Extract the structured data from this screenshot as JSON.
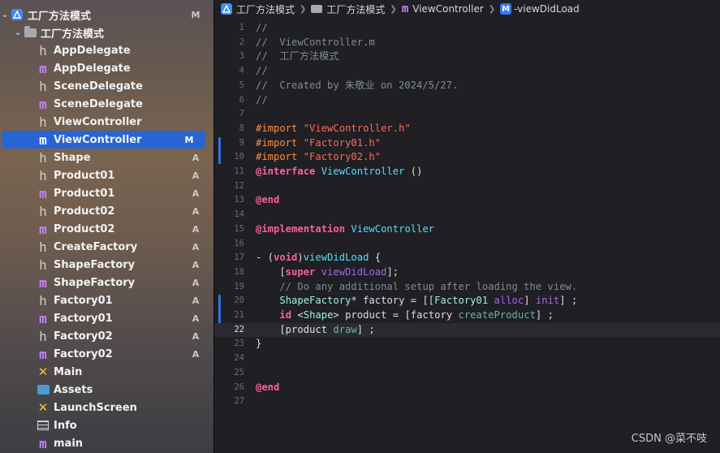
{
  "navigator": {
    "project": {
      "label": "工厂方法模式",
      "status": "M"
    },
    "group": {
      "label": "工厂方法模式"
    },
    "files": [
      {
        "label": "AppDelegate",
        "kind": "h",
        "status": ""
      },
      {
        "label": "AppDelegate",
        "kind": "m",
        "status": ""
      },
      {
        "label": "SceneDelegate",
        "kind": "h",
        "status": ""
      },
      {
        "label": "SceneDelegate",
        "kind": "m",
        "status": ""
      },
      {
        "label": "ViewController",
        "kind": "h",
        "status": ""
      },
      {
        "label": "ViewController",
        "kind": "m",
        "status": "M",
        "selected": true
      },
      {
        "label": "Shape",
        "kind": "h",
        "status": "A"
      },
      {
        "label": "Product01",
        "kind": "h",
        "status": "A"
      },
      {
        "label": "Product01",
        "kind": "m",
        "status": "A"
      },
      {
        "label": "Product02",
        "kind": "h",
        "status": "A"
      },
      {
        "label": "Product02",
        "kind": "m",
        "status": "A"
      },
      {
        "label": "CreateFactory",
        "kind": "h",
        "status": "A"
      },
      {
        "label": "ShapeFactory",
        "kind": "h",
        "status": "A"
      },
      {
        "label": "ShapeFactory",
        "kind": "m",
        "status": "A"
      },
      {
        "label": "Factory01",
        "kind": "h",
        "status": "A"
      },
      {
        "label": "Factory01",
        "kind": "m",
        "status": "A"
      },
      {
        "label": "Factory02",
        "kind": "h",
        "status": "A"
      },
      {
        "label": "Factory02",
        "kind": "m",
        "status": "A"
      },
      {
        "label": "Main",
        "kind": "storyboard",
        "status": ""
      },
      {
        "label": "Assets",
        "kind": "assets",
        "status": ""
      },
      {
        "label": "LaunchScreen",
        "kind": "storyboard",
        "status": ""
      },
      {
        "label": "Info",
        "kind": "plist",
        "status": ""
      },
      {
        "label": "main",
        "kind": "m",
        "status": ""
      }
    ]
  },
  "jumpbar": {
    "project": "工厂方法模式",
    "group": "工厂方法模式",
    "file": "ViewController",
    "method_badge": "M",
    "method": "-viewDidLoad"
  },
  "editor": {
    "current_line": 22,
    "changed_lines": [
      9,
      10,
      20,
      21,
      22
    ],
    "lines": [
      {
        "n": "1",
        "tokens": [
          [
            "c",
            "//"
          ]
        ]
      },
      {
        "n": "2",
        "tokens": [
          [
            "c",
            "//  ViewController.m"
          ]
        ]
      },
      {
        "n": "3",
        "tokens": [
          [
            "c",
            "//  工厂方法模式"
          ]
        ]
      },
      {
        "n": "4",
        "tokens": [
          [
            "c",
            "//"
          ]
        ]
      },
      {
        "n": "5",
        "tokens": [
          [
            "c",
            "//  Created by 朱敬业 on 2024/5/27."
          ]
        ]
      },
      {
        "n": "6",
        "tokens": [
          [
            "c",
            "//"
          ]
        ]
      },
      {
        "n": "7",
        "tokens": []
      },
      {
        "n": "8",
        "tokens": [
          [
            "p",
            "#import "
          ],
          [
            "s",
            "\"ViewController.h\""
          ]
        ]
      },
      {
        "n": "9",
        "tokens": [
          [
            "p",
            "#import "
          ],
          [
            "s",
            "\"Factory01.h\""
          ]
        ]
      },
      {
        "n": "10",
        "tokens": [
          [
            "p",
            "#import "
          ],
          [
            "s",
            "\"Factory02.h\""
          ]
        ]
      },
      {
        "n": "11",
        "tokens": [
          [
            "k",
            "@interface"
          ],
          [
            "t",
            " "
          ],
          [
            "y",
            "ViewController"
          ],
          [
            "t",
            " ()"
          ]
        ]
      },
      {
        "n": "12",
        "tokens": []
      },
      {
        "n": "13",
        "tokens": [
          [
            "k",
            "@end"
          ]
        ]
      },
      {
        "n": "14",
        "tokens": []
      },
      {
        "n": "15",
        "tokens": [
          [
            "k",
            "@implementation"
          ],
          [
            "t",
            " "
          ],
          [
            "y",
            "ViewController"
          ]
        ]
      },
      {
        "n": "16",
        "tokens": []
      },
      {
        "n": "17",
        "tokens": [
          [
            "t",
            "- ("
          ],
          [
            "k",
            "void"
          ],
          [
            "t",
            ")"
          ],
          [
            "y",
            "viewDidLoad"
          ],
          [
            "t",
            " {"
          ]
        ]
      },
      {
        "n": "18",
        "tokens": [
          [
            "t",
            "    ["
          ],
          [
            "k",
            "super"
          ],
          [
            "t",
            " "
          ],
          [
            "m",
            "viewDidLoad"
          ],
          [
            "t",
            "];"
          ]
        ]
      },
      {
        "n": "19",
        "tokens": [
          [
            "c",
            "    // Do any additional setup after loading the view."
          ]
        ]
      },
      {
        "n": "20",
        "tokens": [
          [
            "t",
            "    "
          ],
          [
            "l",
            "ShapeFactory"
          ],
          [
            "t",
            "* factory = [["
          ],
          [
            "l",
            "Factory01"
          ],
          [
            "t",
            " "
          ],
          [
            "m",
            "alloc"
          ],
          [
            "t",
            "] "
          ],
          [
            "m",
            "init"
          ],
          [
            "t",
            "] ;"
          ]
        ]
      },
      {
        "n": "21",
        "tokens": [
          [
            "t",
            "    "
          ],
          [
            "k",
            "id"
          ],
          [
            "t",
            " <"
          ],
          [
            "l",
            "Shape"
          ],
          [
            "t",
            "> product = [factory "
          ],
          [
            "f",
            "createProduct"
          ],
          [
            "t",
            "] ;"
          ]
        ]
      },
      {
        "n": "22",
        "tokens": [
          [
            "t",
            "    [product "
          ],
          [
            "f",
            "draw"
          ],
          [
            "t",
            "] ;"
          ]
        ]
      },
      {
        "n": "23",
        "tokens": [
          [
            "t",
            "}"
          ]
        ]
      },
      {
        "n": "24",
        "tokens": []
      },
      {
        "n": "25",
        "tokens": []
      },
      {
        "n": "26",
        "tokens": [
          [
            "k",
            "@end"
          ]
        ]
      },
      {
        "n": "27",
        "tokens": []
      }
    ]
  },
  "watermark": "CSDN @菜不吱",
  "colors": {
    "selection": "#2864d2",
    "comment": "#7f8c98",
    "preprocessor": "#fd8f3f",
    "string": "#fc6a5d",
    "keyword": "#fc5fa3",
    "declaration": "#5dd8ff",
    "class": "#9ef1dd",
    "method": "#a167e6",
    "project_method": "#67b7a4",
    "change_bar": "#2b74e0"
  }
}
